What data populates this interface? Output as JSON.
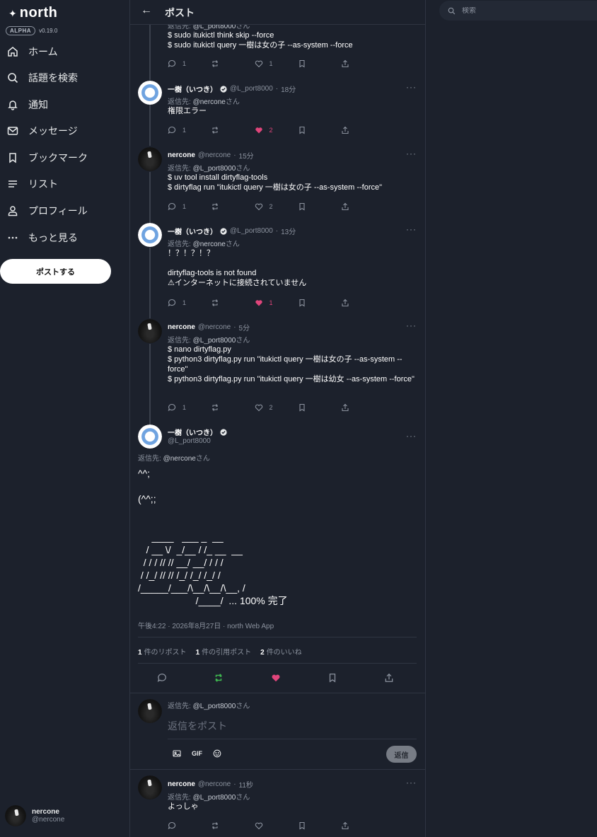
{
  "app": {
    "brand": "north",
    "alpha_badge": "ALPHA",
    "version": "v0.19.0"
  },
  "sidebar": {
    "items": [
      {
        "label": "ホーム",
        "icon": "home-icon"
      },
      {
        "label": "話題を検索",
        "icon": "search-icon"
      },
      {
        "label": "通知",
        "icon": "bell-icon"
      },
      {
        "label": "メッセージ",
        "icon": "mail-icon"
      },
      {
        "label": "ブックマーク",
        "icon": "bookmark-icon"
      },
      {
        "label": "リスト",
        "icon": "list-icon"
      },
      {
        "label": "プロフィール",
        "icon": "profile-icon"
      },
      {
        "label": "もっと見る",
        "icon": "more-icon"
      }
    ],
    "post_button": "ポストする",
    "current_user": {
      "name": "nercone",
      "handle": "@nercone"
    }
  },
  "header": {
    "title": "ポスト"
  },
  "thread": [
    {
      "reply_to_prefix": "返信先:",
      "reply_to": "@L_port8000",
      "reply_suffix": "さん",
      "body": "$ sudo itukictl think skip --force\n$ sudo itukictl query 一樹は女の子 --as-system --force",
      "replies": "1",
      "likes": "1",
      "liked": false
    },
    {
      "name": "一樹（いつき）",
      "verified": true,
      "handle": "@L_port8000",
      "time": "18分",
      "reply_to_prefix": "返信先:",
      "reply_to": "@nercone",
      "reply_suffix": "さん",
      "body": "権限エラー",
      "replies": "1",
      "likes": "2",
      "liked": true
    },
    {
      "name": "nercone",
      "handle": "@nercone",
      "time": "15分",
      "reply_to_prefix": "返信先:",
      "reply_to": "@L_port8000",
      "reply_suffix": "さん",
      "body": "$ uv tool install dirtyflag-tools\n$ dirtyflag run \"itukictl query 一樹は女の子 --as-system --force\"",
      "replies": "1",
      "likes": "2",
      "liked": false
    },
    {
      "name": "一樹（いつき）",
      "verified": true,
      "handle": "@L_port8000",
      "time": "13分",
      "reply_to_prefix": "返信先:",
      "reply_to": "@nercone",
      "reply_suffix": "さん",
      "body": "！？！？！？\n\ndirtyflag-tools is not found\n⚠インターネットに接続されていません",
      "replies": "1",
      "likes": "1",
      "liked": true
    },
    {
      "name": "nercone",
      "handle": "@nercone",
      "time": "5分",
      "reply_to_prefix": "返信先:",
      "reply_to": "@L_port8000",
      "reply_suffix": "さん",
      "body": "$ nano dirtyflag.py\n$ python3 dirtyflag.py run \"itukictl query 一樹は女の子 --as-system --force\"\n$ python3 dirtyflag.py run \"itukictl query 一樹は幼女 --as-system --force\"",
      "replies": "1",
      "likes": "2",
      "liked": false
    }
  ],
  "main_post": {
    "name": "一樹（いつき）",
    "verified": true,
    "handle": "@L_port8000",
    "reply_to_prefix": "返信先:",
    "reply_to": "@nercone",
    "reply_suffix": "さん",
    "body": "^^;\n\n(^^;;\n\n\n     ____   ___ _  __\n   / __ \\/  _/__ / /_ __  __\n  / / / // // __/ __/ / / /\n / /_/ // // /_/ /_/ /_/ /\n/_____/___/\\__/\\__/\\__, /\n                     /____/  ... 100% 完了",
    "timestamp": "午後4:22 · 2026年8月27日 · north Web App",
    "stats": [
      {
        "count": "1",
        "label": "件のリポスト"
      },
      {
        "count": "1",
        "label": "件の引用ポスト"
      },
      {
        "count": "2",
        "label": "件のいいね"
      }
    ],
    "reposted": true,
    "liked": true
  },
  "composer": {
    "reply_to_prefix": "返信先:",
    "reply_to": "@L_port8000",
    "reply_suffix": "さん",
    "placeholder": "返信をポスト",
    "gif_label": "GIF",
    "reply_button": "返信"
  },
  "reply_post": {
    "name": "nercone",
    "handle": "@nercone",
    "time": "11秒",
    "reply_to_prefix": "返信先:",
    "reply_to": "@L_port8000",
    "reply_suffix": "さん",
    "body": "よっしゃ"
  },
  "search": {
    "placeholder": "検索"
  },
  "colors": {
    "background": "#1c212c",
    "like": "#e0457b",
    "repost": "#3fb950",
    "border": "#2f3542"
  }
}
